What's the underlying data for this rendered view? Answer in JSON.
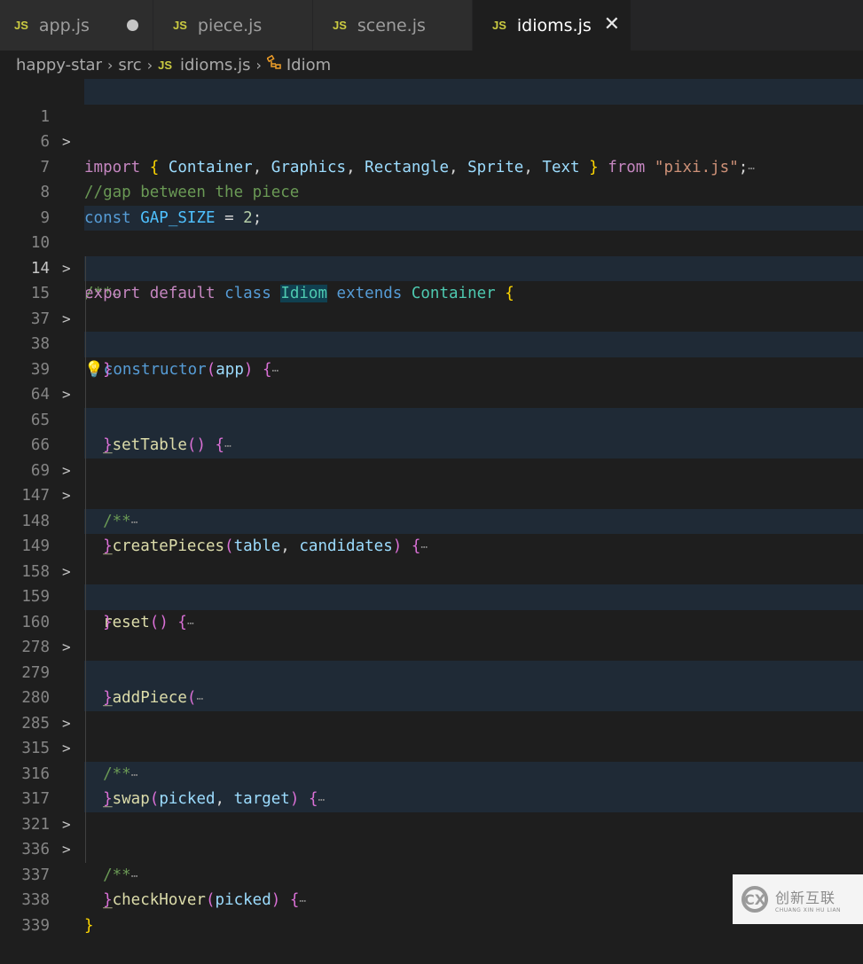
{
  "tabs": [
    {
      "label": "app.js",
      "icon": "JS",
      "modified": true,
      "active": false
    },
    {
      "label": "piece.js",
      "icon": "JS",
      "active": false
    },
    {
      "label": "scene.js",
      "icon": "JS",
      "active": false
    },
    {
      "label": "idioms.js",
      "icon": "JS",
      "active": true,
      "close": "✕"
    }
  ],
  "breadcrumb": {
    "items": [
      "happy-star",
      "src",
      "idioms.js",
      "Idiom"
    ],
    "separator": "›",
    "file_icon": "JS",
    "symbol_icon": "class-symbol-icon"
  },
  "lines": [
    {
      "n": "1",
      "fold": true
    },
    {
      "n": "6"
    },
    {
      "n": "7"
    },
    {
      "n": "8"
    },
    {
      "n": "9"
    },
    {
      "n": "10",
      "fold": true
    },
    {
      "n": "14",
      "current": true
    },
    {
      "n": "15",
      "fold": true
    },
    {
      "n": "37"
    },
    {
      "n": "38"
    },
    {
      "n": "39",
      "fold": true
    },
    {
      "n": "64"
    },
    {
      "n": "65"
    },
    {
      "n": "66",
      "fold": true
    },
    {
      "n": "69",
      "fold": true
    },
    {
      "n": "147"
    },
    {
      "n": "148"
    },
    {
      "n": "149",
      "fold": true
    },
    {
      "n": "158"
    },
    {
      "n": "159"
    },
    {
      "n": "160",
      "fold": true
    },
    {
      "n": "278"
    },
    {
      "n": "279"
    },
    {
      "n": "280",
      "fold": true
    },
    {
      "n": "285",
      "fold": true
    },
    {
      "n": "315"
    },
    {
      "n": "316"
    },
    {
      "n": "317",
      "fold": true
    },
    {
      "n": "321",
      "fold": true
    },
    {
      "n": "336"
    },
    {
      "n": "337"
    },
    {
      "n": "338"
    },
    {
      "n": "339"
    }
  ],
  "code": {
    "l1": {
      "import": "import",
      "ob": "{",
      "names": [
        "Container",
        "Graphics",
        "Rectangle",
        "Sprite",
        "Text"
      ],
      "cb": "}",
      "from": "from",
      "src": "\"pixi.js\"",
      "semi": ";",
      "ell": "⋯"
    },
    "l7": "//gap between the piece",
    "l8": {
      "const": "const",
      "name": "GAP_SIZE",
      "eq": "=",
      "val": "2",
      "semi": ";"
    },
    "l10": {
      "cmt": "/**",
      "ell": "⋯"
    },
    "l14": {
      "export": "export",
      "default": "default",
      "class": "class",
      "name": "Idiom",
      "extends": "extends",
      "base": "Container",
      "ob": "{"
    },
    "l15": {
      "fn": "constructor",
      "params": "app",
      "ell": "⋯"
    },
    "l39": {
      "fn": "_setTable",
      "params": "",
      "ell": "⋯"
    },
    "l66": {
      "cmt": "/**",
      "ell": "⋯"
    },
    "l69": {
      "fn": "_createPieces",
      "p1": "table",
      "p2": "candidates",
      "ell": "⋯"
    },
    "l149": {
      "fn": "reset",
      "ell": "⋯"
    },
    "l160": {
      "fn": "_addPiece",
      "ell": "⋯"
    },
    "l280": {
      "cmt": "/**",
      "ell": "⋯"
    },
    "l285": {
      "fn": "_swap",
      "p1": "picked",
      "p2": "target",
      "ell": "⋯"
    },
    "l317": {
      "cmt": "/**",
      "ell": "⋯"
    },
    "l321": {
      "fn": "_checkHover",
      "p1": "picked",
      "ell": "⋯"
    },
    "close_brace": "}",
    "open_paren": "(",
    "close_paren": ")",
    "open_brace": "{",
    "comma": ","
  },
  "watermark": {
    "logo": "CX",
    "cn": "创新互联",
    "en": "CHUANG XIN HU LIAN"
  }
}
